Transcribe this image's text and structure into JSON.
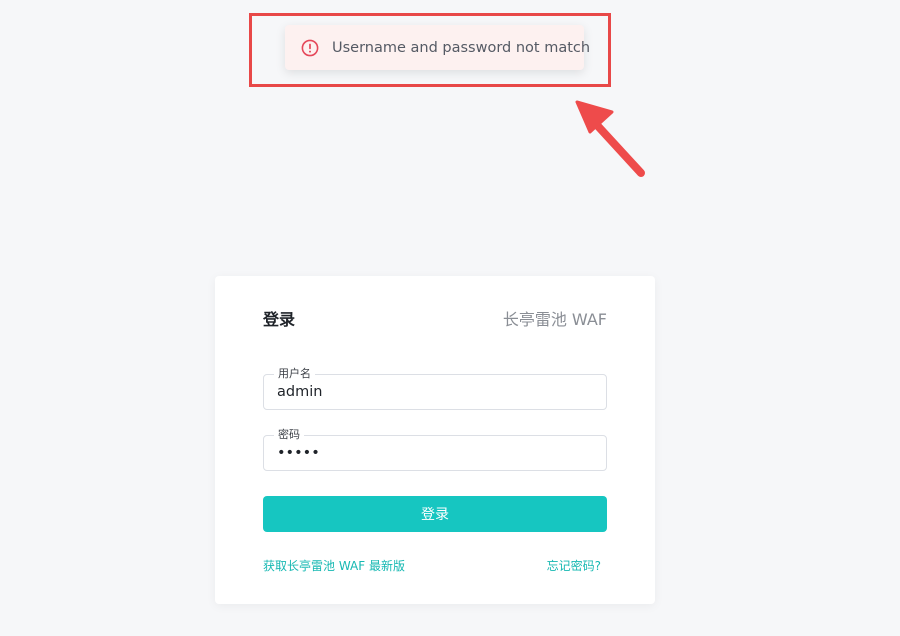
{
  "toast": {
    "message": "Username and password not match",
    "icon": "alert-circle-icon",
    "icon_color": "#e5485a",
    "background": "#fdf1f0"
  },
  "annotation": {
    "box_color": "#e84848",
    "arrow_color": "#ee4b4b"
  },
  "login": {
    "title": "登录",
    "brand": "长亭雷池 WAF",
    "username_label": "用户名",
    "username_value": "admin",
    "password_label": "密码",
    "password_value": "•••••",
    "submit_label": "登录",
    "latest_link": "获取长亭雷池 WAF 最新版",
    "forgot_link": "忘记密码?",
    "accent_color": "#16c6c1"
  }
}
